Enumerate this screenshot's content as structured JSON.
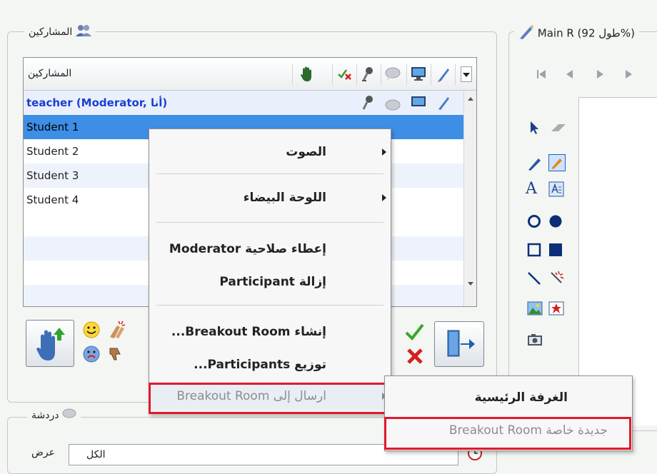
{
  "participants_panel": {
    "title": "المشاركين",
    "column_header": "المشاركين",
    "rows": [
      {
        "name": "teacher (Moderator, أنا)"
      },
      {
        "name": "Student 1"
      },
      {
        "name": "Student 2"
      },
      {
        "name": "Student 3"
      },
      {
        "name": "Student 4"
      }
    ]
  },
  "whiteboard_panel": {
    "title": "Main R (طول 92%)"
  },
  "chat_panel": {
    "title": "دردشة",
    "dropdown_value": "الكل",
    "to_label": "عرض"
  },
  "context_menu": {
    "items": [
      {
        "label": "الصوت",
        "has_submenu": true
      },
      {
        "label": "اللوحة البيضاء",
        "has_submenu": true
      },
      {
        "label": "إعطاء صلاحية Moderator"
      },
      {
        "label": "إزالة Participant"
      },
      {
        "label": "إنشاء Breakout Room..."
      },
      {
        "label": "توزيع Participants..."
      },
      {
        "label": "ارسال إلى Breakout Room",
        "disabled": true,
        "has_submenu": true
      }
    ]
  },
  "submenu": {
    "items": [
      {
        "label": "الغرفة الرئيسية"
      },
      {
        "label": "جديدة خاصة Breakout Room",
        "disabled": true
      }
    ]
  },
  "colors": {
    "selection": "#3d8ee5",
    "highlight_box": "#e0192b",
    "teacher_text": "#1a3fd0"
  }
}
